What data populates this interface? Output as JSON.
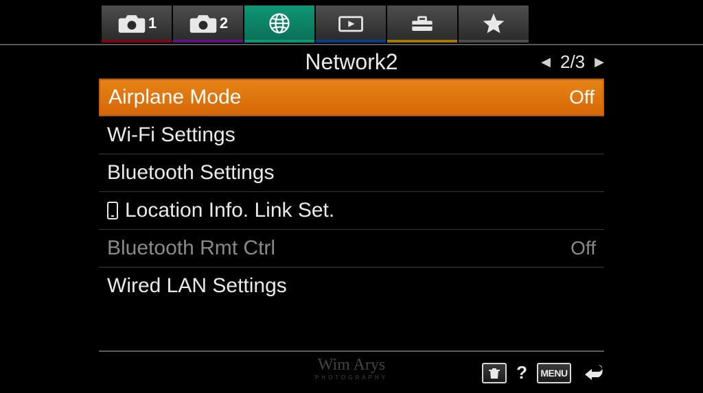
{
  "tabs": {
    "camera1_num": "1",
    "camera2_num": "2"
  },
  "header": {
    "title": "Network2",
    "page": "2/3"
  },
  "items": [
    {
      "label": "Airplane Mode",
      "value": "Off",
      "selected": true,
      "disabled": false,
      "icon": null
    },
    {
      "label": "Wi-Fi Settings",
      "value": "",
      "selected": false,
      "disabled": false,
      "icon": null
    },
    {
      "label": "Bluetooth Settings",
      "value": "",
      "selected": false,
      "disabled": false,
      "icon": null
    },
    {
      "label": "Location Info. Link Set.",
      "value": "",
      "selected": false,
      "disabled": false,
      "icon": "phone"
    },
    {
      "label": "Bluetooth Rmt Ctrl",
      "value": "Off",
      "selected": false,
      "disabled": true,
      "icon": null
    },
    {
      "label": "Wired LAN Settings",
      "value": "",
      "selected": false,
      "disabled": false,
      "icon": null
    }
  ],
  "bottom": {
    "menu_label": "MENU"
  },
  "watermark": {
    "main": "Wim Arys",
    "sub": "PHOTOGRAPHY"
  }
}
